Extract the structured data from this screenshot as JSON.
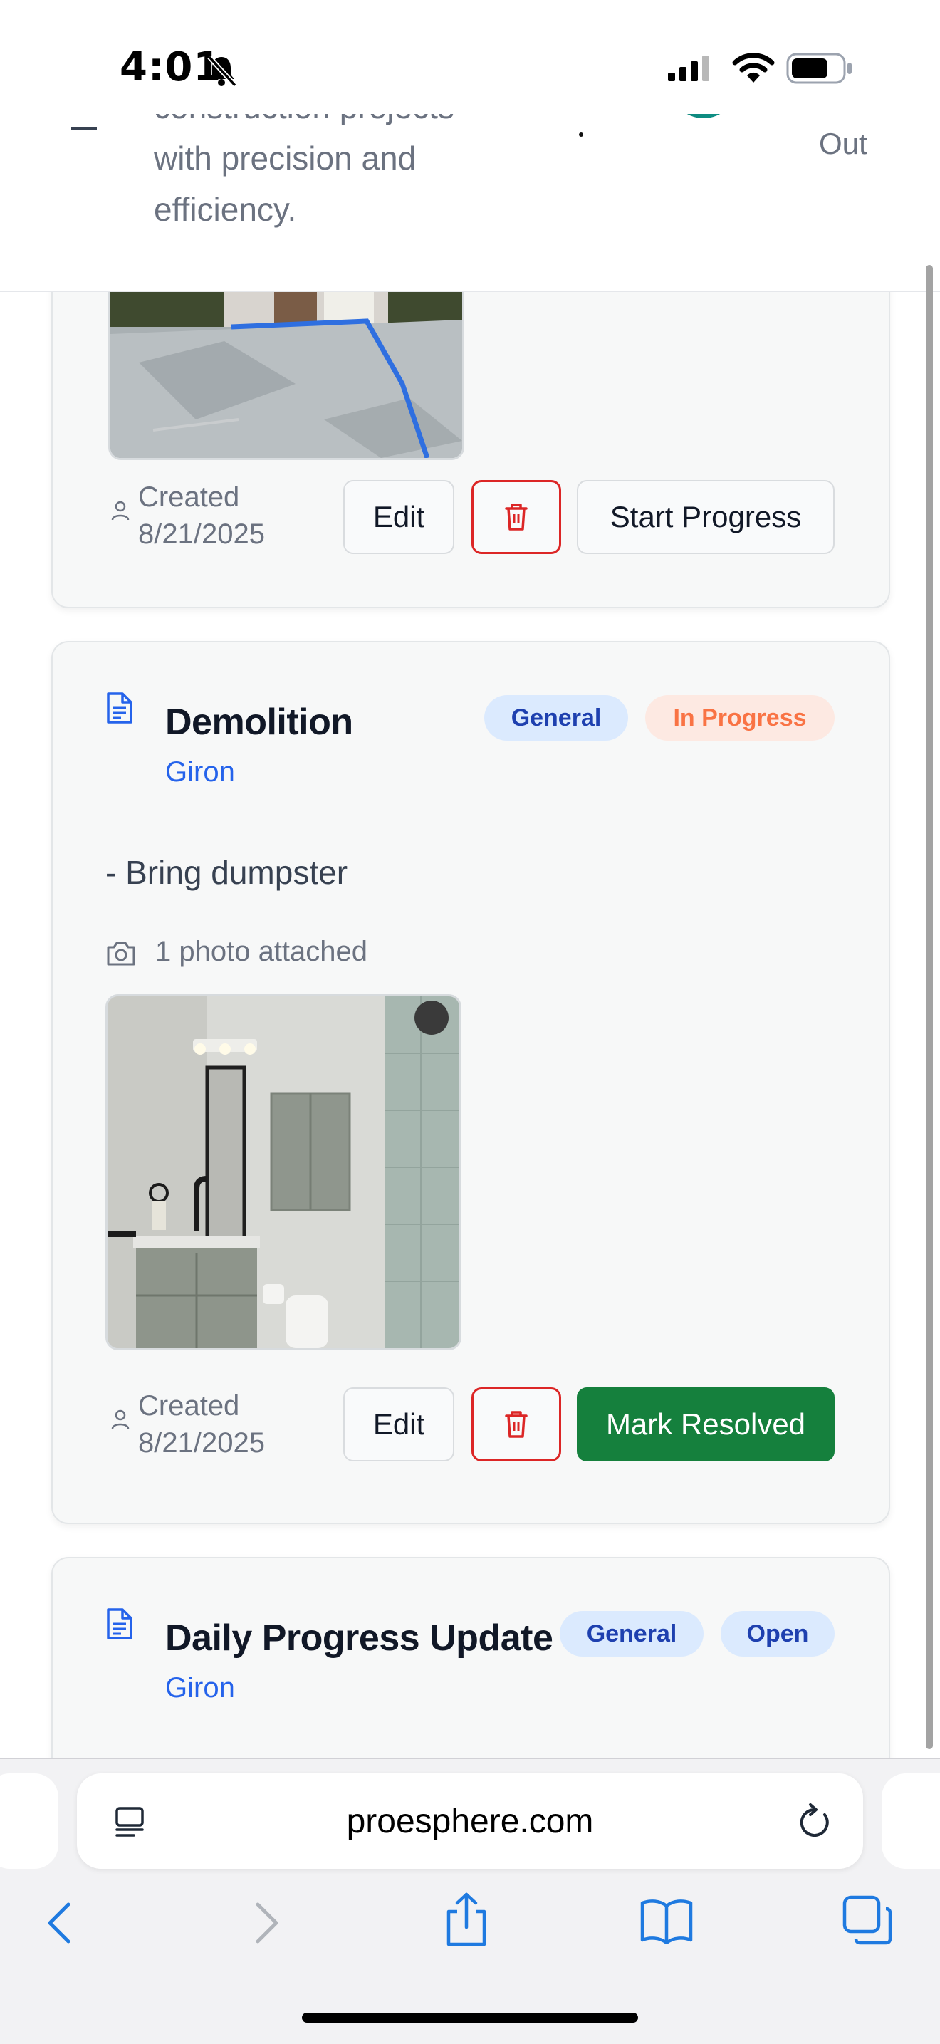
{
  "status_bar": {
    "time": "4:01"
  },
  "header": {
    "tagline_partial": "construction projects",
    "tagline_lines": [
      "with precision and",
      "efficiency."
    ],
    "signout_label": "Out"
  },
  "cards": [
    {
      "created_label": "Created",
      "created_date": "8/21/2025",
      "edit_label": "Edit",
      "action_label": "Start Progress"
    },
    {
      "title": "Demolition",
      "project": "Giron",
      "category_badge": "General",
      "status_badge": "In Progress",
      "description": "- Bring dumpster",
      "photo_count": "1 photo attached",
      "created_label": "Created",
      "created_date": "8/21/2025",
      "edit_label": "Edit",
      "action_label": "Mark Resolved"
    },
    {
      "title": "Daily Progress Update",
      "project": "Giron",
      "category_badge": "General",
      "status_badge": "Open"
    }
  ],
  "browser": {
    "url": "proesphere.com"
  },
  "colors": {
    "accent_blue": "#2563eb",
    "resolve_green": "#15803d",
    "delete_red": "#dc2626",
    "in_progress_orange": "#f97344"
  }
}
